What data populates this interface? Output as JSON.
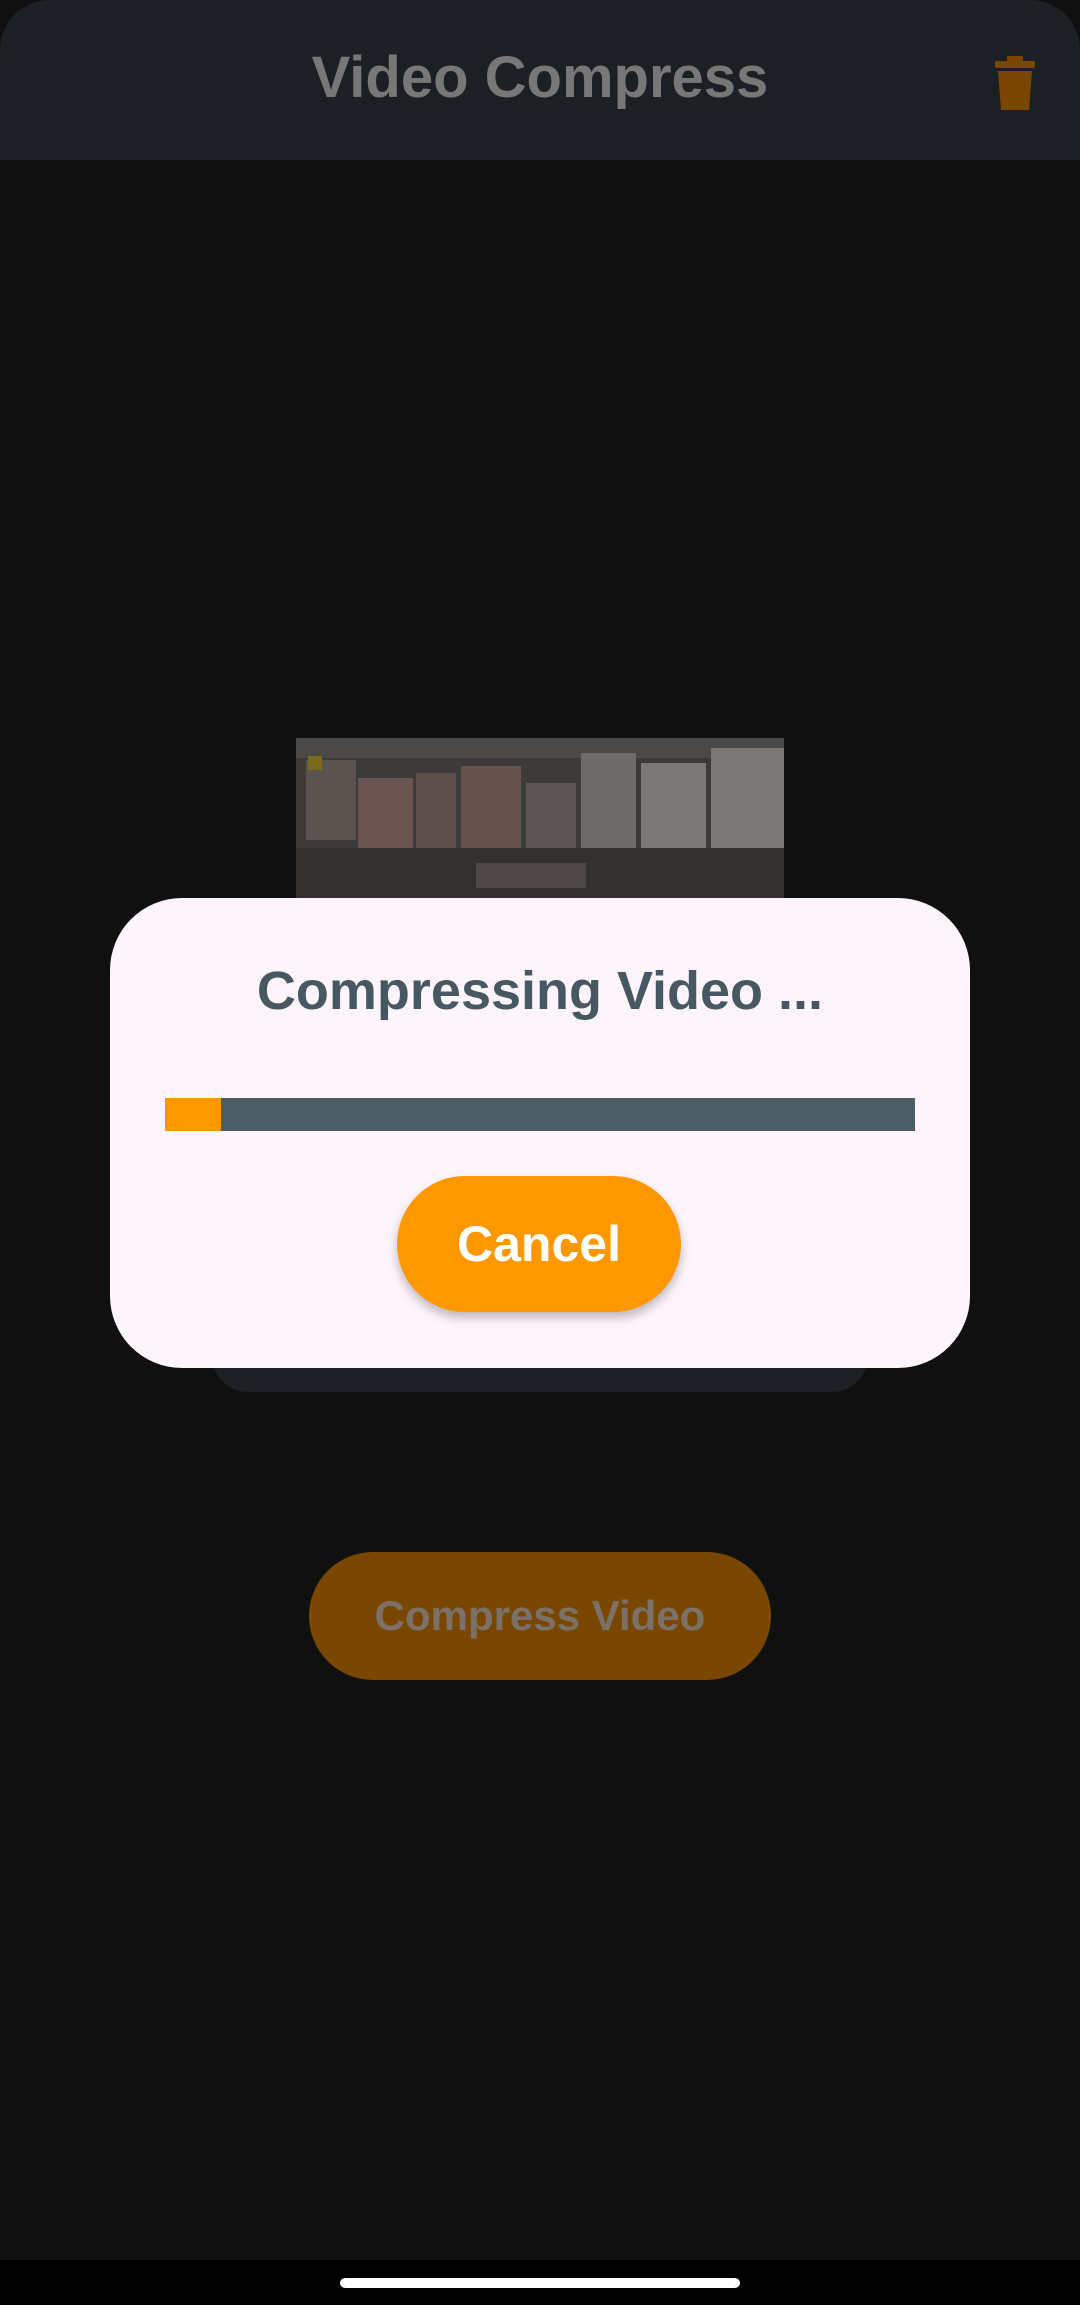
{
  "app_bar": {
    "title": "Video Compress",
    "delete_icon": "trash-icon"
  },
  "video": {
    "thumbnail": "city-aerial-thumbnail"
  },
  "main": {
    "compress_label": "Compress Video"
  },
  "dialog": {
    "title": "Compressing Video ...",
    "progress_fraction": 0.075,
    "cancel_label": "Cancel"
  },
  "colors": {
    "accent": "#ff9800",
    "progress_track": "#4b5c66",
    "dialog_bg": "#fdf5fb"
  }
}
